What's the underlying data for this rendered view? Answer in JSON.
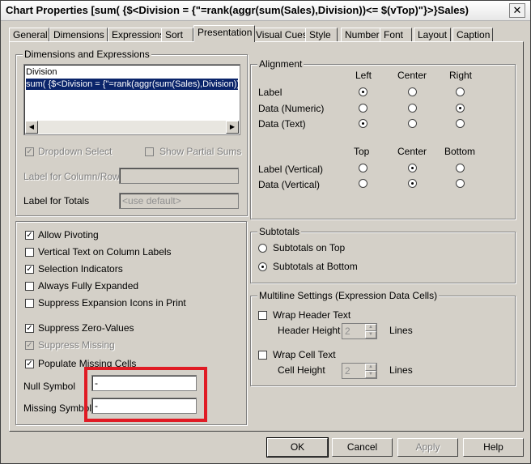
{
  "window": {
    "title": "Chart Properties [sum( {$<Division = {\"=rank(aggr(sum(Sales),Division))<= $(vTop)\"}>}Sales)",
    "close_glyph": "✕"
  },
  "tabs": [
    "General",
    "Dimensions",
    "Expressions",
    "Sort",
    "Presentation",
    "Visual Cues",
    "Style",
    "Number",
    "Font",
    "Layout",
    "Caption"
  ],
  "active_tab": "Presentation",
  "dimensions": {
    "legend": "Dimensions and Expressions",
    "items": [
      "Division",
      "sum( {$<Division = {\"=rank(aggr(sum(Sales),Division))<= $(vTop)\"}>}Sales)"
    ],
    "selected_index": 1,
    "dropdown_select": "Dropdown Select",
    "show_partial_sums": "Show Partial Sums",
    "label_for_column_row": "Label for Column/Row",
    "label_for_totals": "Label for Totals",
    "totals_placeholder": "<use default>"
  },
  "alignment": {
    "legend": "Alignment",
    "cols": [
      "Left",
      "Center",
      "Right"
    ],
    "rows": [
      {
        "label": "Label",
        "selected": 0
      },
      {
        "label": "Data (Numeric)",
        "selected": 2
      },
      {
        "label": "Data (Text)",
        "selected": 0
      }
    ],
    "vcols": [
      "Top",
      "Center",
      "Bottom"
    ],
    "vrows": [
      {
        "label": "Label (Vertical)",
        "selected": 1
      },
      {
        "label": "Data (Vertical)",
        "selected": 1
      }
    ]
  },
  "options": [
    {
      "label": "Allow Pivoting",
      "checked": true,
      "disabled": false
    },
    {
      "label": "Vertical Text on Column Labels",
      "checked": false,
      "disabled": false
    },
    {
      "label": "Selection Indicators",
      "checked": true,
      "disabled": false
    },
    {
      "label": "Always Fully Expanded",
      "checked": false,
      "disabled": false
    },
    {
      "label": "Suppress Expansion Icons in Print",
      "checked": false,
      "disabled": false
    },
    {
      "label": "Suppress Zero-Values",
      "checked": true,
      "disabled": false
    },
    {
      "label": "Suppress Missing",
      "checked": true,
      "disabled": true
    },
    {
      "label": "Populate Missing Cells",
      "checked": true,
      "disabled": false
    }
  ],
  "null_symbol": {
    "label": "Null Symbol",
    "value": "-"
  },
  "missing_symbol": {
    "label": "Missing Symbol",
    "value": "-"
  },
  "subtotals": {
    "legend": "Subtotals",
    "on_top": "Subtotals on Top",
    "at_bottom": "Subtotals at Bottom",
    "selected": "at_bottom"
  },
  "multiline": {
    "legend": "Multiline Settings (Expression Data Cells)",
    "wrap_header": "Wrap Header Text",
    "header_height": "Header Height",
    "header_value": "2",
    "wrap_cell": "Wrap Cell Text",
    "cell_height": "Cell Height",
    "cell_value": "2",
    "lines": "Lines"
  },
  "buttons": {
    "ok": "OK",
    "cancel": "Cancel",
    "apply": "Apply",
    "help": "Help"
  },
  "colors": {
    "highlight": "#e01b24",
    "selection": "#0a246a"
  }
}
